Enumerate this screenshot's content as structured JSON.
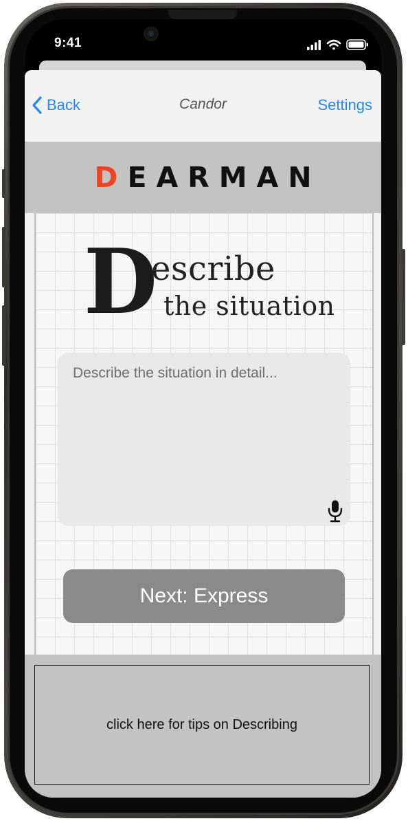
{
  "status_bar": {
    "time": "9:41",
    "icons": [
      "cellular-signal-icon",
      "wifi-icon",
      "battery-icon"
    ]
  },
  "nav": {
    "back_label": "Back",
    "title": "Candor",
    "settings_label": "Settings"
  },
  "brand": {
    "first_letter": "D",
    "rest": "EARMAN",
    "accent_color": "#ef4423"
  },
  "heading": {
    "letter": "D",
    "line1": "escribe",
    "line2": "the situation"
  },
  "input": {
    "placeholder": "Describe the situation in detail...",
    "value": ""
  },
  "next_button": {
    "label": "Next: Express"
  },
  "tips": {
    "label": "click here for tips on Describing"
  },
  "colors": {
    "link": "#1e88ff",
    "brand_bar": "#c3c3c3",
    "button": "#8a8a8a"
  }
}
